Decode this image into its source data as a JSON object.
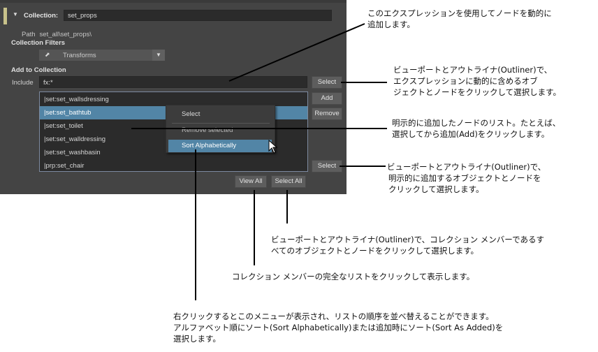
{
  "panel": {
    "collection_label": "Collection:",
    "collection_name": "set_props",
    "path_label": "Path",
    "path_value": "set_all\\set_props\\",
    "filters_label": "Collection Filters",
    "filter_value": "Transforms",
    "add_label": "Add to Collection",
    "include_label": "Include",
    "include_value": "fx:*",
    "buttons": {
      "select_top": "Select",
      "add": "Add",
      "remove": "Remove",
      "select_bottom": "Select",
      "view_all": "View All",
      "select_all": "Select All"
    },
    "list_items": [
      "|set:set_wallsdressing",
      "|set:set_bathtub",
      "|set:set_toilet",
      "|set:set_walldressing",
      "|set:set_washbasin",
      "|prp:set_chair"
    ],
    "selected_index": 1,
    "context_menu": {
      "items": [
        "Select",
        "Remove selected",
        "Sort Alphabetically"
      ]
    },
    "icons": {
      "collapse": "triangle-down-icon",
      "filter": "transform-filter-icon",
      "dropdown": "chevron-down-icon",
      "cursor": "mouse-pointer-icon"
    }
  },
  "annotations": {
    "a1": [
      "このエクスプレッションを使用してノードを動的に",
      "追加します。"
    ],
    "a2": [
      "ビューポートとアウトライナ(Outliner)で、",
      "エクスプレッションに動的に含めるオブ",
      "ジェクトとノードをクリックして選択します。"
    ],
    "a3": [
      "明示的に追加したノードのリスト。たとえば、",
      "選択してから追加(Add)をクリックします。"
    ],
    "a4": [
      "ビューポートとアウトライナ(Outliner)で、",
      "明示的に追加するオブジェクトとノードを",
      "クリックして選択します。"
    ],
    "a5": [
      "ビューポートとアウトライナ(Outliner)で、コレクション メンバーであるす",
      "べてのオブジェクトとノードをクリックして選択します。"
    ],
    "a6": [
      "コレクション メンバーの完全なリストをクリックして表示します。"
    ],
    "a7": [
      "右クリックするとこのメニューが表示され、リストの順序を並べ替えることができます。",
      "アルファベット順にソート(Sort Alphabetically)または追加時にソート(Sort As Added)を",
      "選択します。"
    ]
  },
  "colors": {
    "panel_bg": "#444444",
    "field_bg": "#2b2b2b",
    "selection": "#5285a6",
    "accent": "#c8c28a"
  }
}
